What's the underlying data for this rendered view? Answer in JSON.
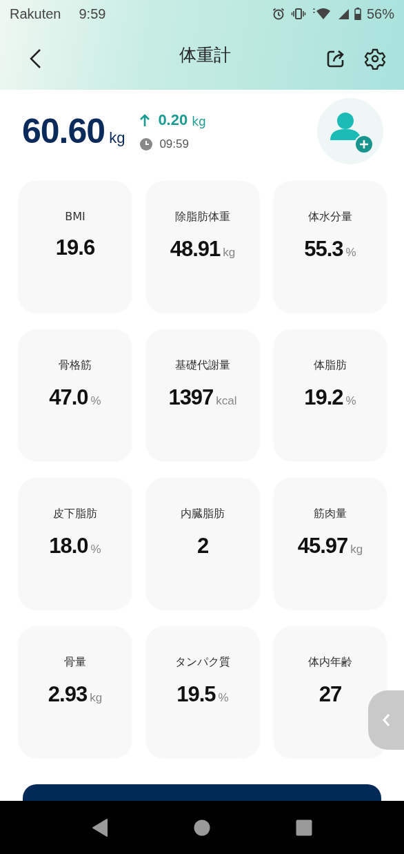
{
  "status_bar": {
    "carrier": "Rakuten",
    "time": "9:59",
    "battery": "56%"
  },
  "header": {
    "title": "体重計"
  },
  "weight": {
    "value": "60.60",
    "unit": "kg",
    "change": "0.20",
    "change_unit": "kg",
    "time": "09:59"
  },
  "metrics": [
    {
      "label": "BMI",
      "value": "19.6"
    },
    {
      "label": "除脂肪体重",
      "value": "48.91",
      "unit": "kg"
    },
    {
      "label": "体水分量",
      "value": "55.3",
      "unit": "%"
    },
    {
      "label": "骨格筋",
      "value": "47.0",
      "unit": "%"
    },
    {
      "label": "基礎代謝量",
      "value": "1397",
      "unit": "kcal"
    },
    {
      "label": "体脂肪",
      "value": "19.2",
      "unit": "%"
    },
    {
      "label": "皮下脂肪",
      "value": "18.0",
      "unit": "%"
    },
    {
      "label": "内臓脂肪",
      "value": "2"
    },
    {
      "label": "筋肉量",
      "value": "45.97",
      "unit": "kg"
    },
    {
      "label": "骨量",
      "value": "2.93",
      "unit": "kg"
    },
    {
      "label": "タンパク質",
      "value": "19.5",
      "unit": "%"
    },
    {
      "label": "体内年齢",
      "value": "27"
    }
  ]
}
